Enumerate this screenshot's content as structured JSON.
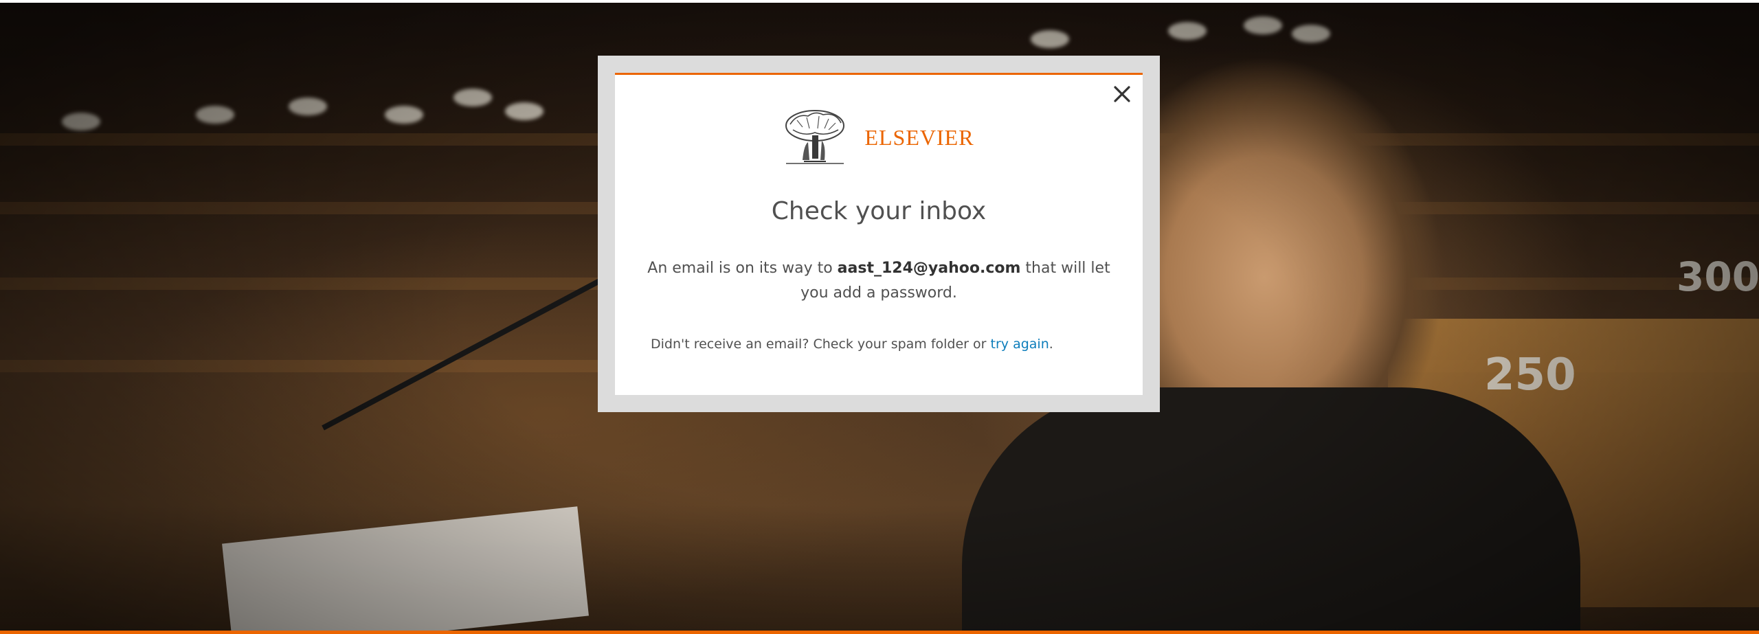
{
  "modal": {
    "brand": "ELSEVIER",
    "title": "Check your inbox",
    "message_prefix": "An email is on its way to",
    "email": "aast_124@yahoo.com",
    "message_suffix": "that will let you add a password.",
    "retry_prefix": "Didn't receive an email? Check your spam folder or",
    "retry_link": "try again",
    "retry_suffix": ".",
    "close_icon": "close-icon"
  },
  "background": {
    "seat_numbers": [
      "300",
      "250"
    ]
  },
  "colors": {
    "accent": "#eb6500",
    "link": "#0c7dbb",
    "text": "#505050",
    "modal_frame": "#dcdcdc"
  }
}
